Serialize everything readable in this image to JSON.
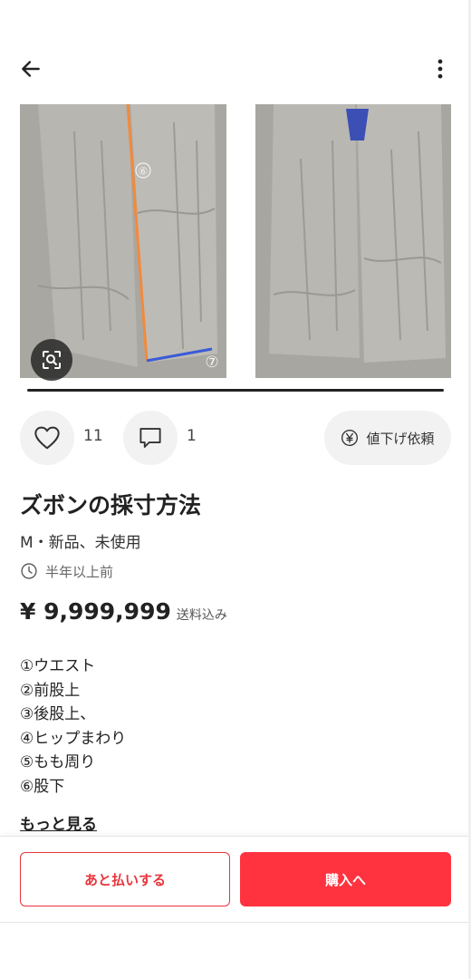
{
  "header": {
    "back_icon": "arrow-left-icon",
    "more_icon": "more-vertical-icon"
  },
  "gallery": {
    "photos": [
      {
        "description_marks": [
          "⑥",
          "⑦"
        ]
      },
      {}
    ],
    "zoom_icon": "image-search-icon"
  },
  "actions": {
    "like_icon": "heart-icon",
    "like_count": "11",
    "comment_icon": "speech-bubble-icon",
    "comment_count": "1",
    "price_offer_icon": "yen-circle-icon",
    "price_offer_label": "値下げ依頼"
  },
  "item": {
    "title": "ズボンの採寸方法",
    "condition": "M・新品、未使用",
    "posted_icon": "clock-icon",
    "posted": "半年以上前",
    "price": "¥ 9,999,999",
    "shipping": "送料込み",
    "description": [
      "①ウエスト",
      "②前股上",
      "③後股上、",
      "④ヒップまわり",
      "⑤もも周り",
      "⑥股下"
    ],
    "more_label": "もっと見る"
  },
  "bottom": {
    "pay_later_label": "あと払いする",
    "buy_label": "購入へ"
  },
  "colors": {
    "accent": "#ff333f",
    "accent_outline": "#e8343c",
    "chip_bg": "#f2f2f2"
  }
}
